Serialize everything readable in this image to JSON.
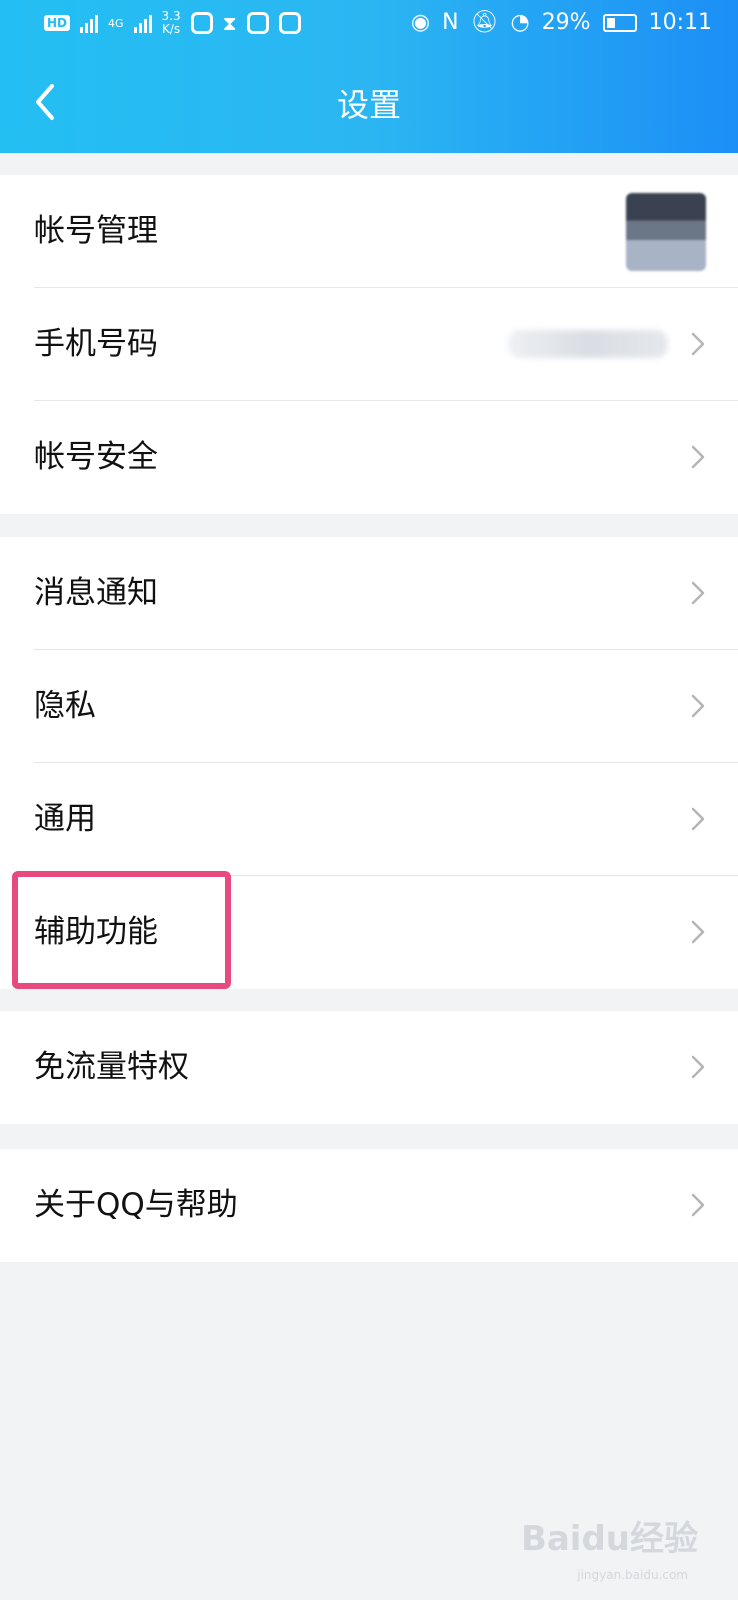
{
  "status_bar": {
    "hd": "HD",
    "net": "4G",
    "speed_value": "3.3",
    "speed_unit": "K/s",
    "battery": "29%",
    "time": "10:11"
  },
  "header": {
    "title": "设置",
    "back_icon": "chevron-left-icon"
  },
  "groups": [
    {
      "items": [
        {
          "label": "帐号管理",
          "icon": "avatar"
        },
        {
          "label": "手机号码",
          "icon": "chevron-right-icon"
        },
        {
          "label": "帐号安全",
          "icon": "chevron-right-icon"
        }
      ]
    },
    {
      "items": [
        {
          "label": "消息通知",
          "icon": "chevron-right-icon"
        },
        {
          "label": "隐私",
          "icon": "chevron-right-icon"
        },
        {
          "label": "通用",
          "icon": "chevron-right-icon"
        },
        {
          "label": "辅助功能",
          "icon": "chevron-right-icon",
          "highlighted": true
        }
      ]
    },
    {
      "items": [
        {
          "label": "免流量特权",
          "icon": "chevron-right-icon"
        }
      ]
    },
    {
      "items": [
        {
          "label": "关于QQ与帮助",
          "icon": "chevron-right-icon"
        }
      ]
    }
  ],
  "watermark": {
    "brand": "Baidu经验",
    "url": "jingyan.baidu.com"
  },
  "colors": {
    "header_start": "#23bff3",
    "header_end": "#1c8ff6",
    "highlight": "#e84a7f"
  }
}
